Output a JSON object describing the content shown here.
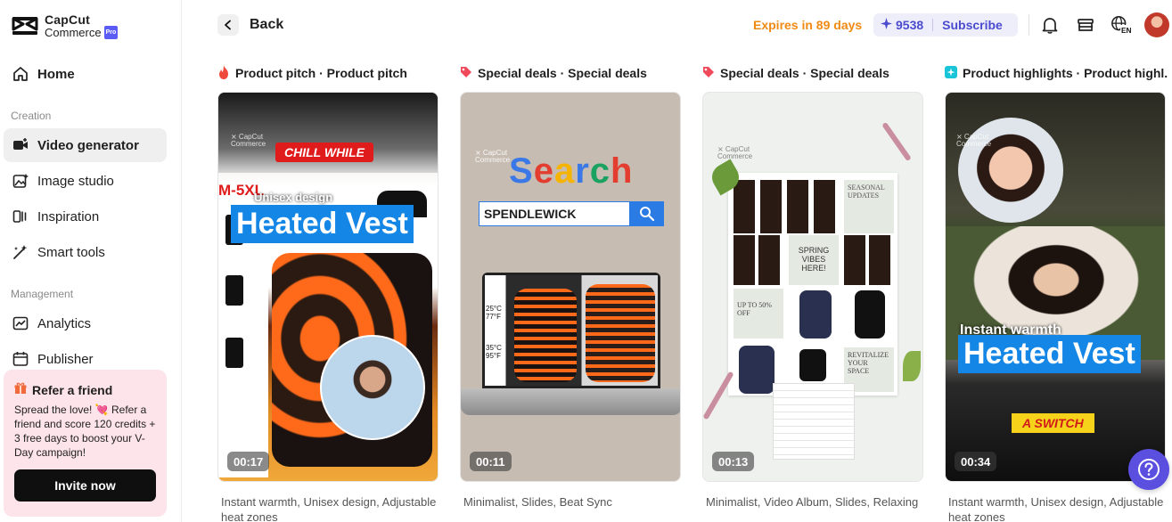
{
  "app": {
    "logo_line1": "CapCut",
    "logo_line2": "Commerce",
    "logo_badge": "Pro"
  },
  "sidebar": {
    "home_label": "Home",
    "creation_label": "Creation",
    "management_label": "Management",
    "items": [
      {
        "label": "Video generator",
        "icon": "video-plus-icon",
        "active": true
      },
      {
        "label": "Image studio",
        "icon": "image-sparkle-icon"
      },
      {
        "label": "Inspiration",
        "icon": "inspiration-icon"
      },
      {
        "label": "Smart tools",
        "icon": "magic-wand-icon"
      },
      {
        "label": "Analytics",
        "icon": "chart-icon"
      },
      {
        "label": "Publisher",
        "icon": "calendar-icon"
      }
    ],
    "refer": {
      "title": "Refer a friend",
      "body": "Spread the love! 💘 Refer a friend and score 120 credits + 3 free days to boost your V-Day campaign!",
      "button": "Invite now"
    }
  },
  "topbar": {
    "back_label": "Back",
    "expires": "Expires in 89 days",
    "credits": "9538",
    "subscribe": "Subscribe",
    "language": "EN"
  },
  "cards": [
    {
      "title": "Product pitch · Product pitch",
      "icon": "fire-icon",
      "duration": "00:17",
      "description": "Instant warmth, Unisex design, Adjustable heat zones",
      "overlay": {
        "banner": "CHILL WHILE",
        "size": "M-5XL",
        "sub": "Unisex design",
        "headline": "Heated Vest"
      }
    },
    {
      "title": "Special deals · Special deals",
      "icon": "tag-icon",
      "duration": "00:11",
      "description": "Minimalist, Slides, Beat Sync",
      "overlay": {
        "search_title": "Search",
        "search_value": "SPENDLEWICK",
        "t1": "25°C\n77°F",
        "t2": "35°C\n95°F"
      }
    },
    {
      "title": "Special deals · Special deals",
      "icon": "tag-icon",
      "duration": "00:13",
      "description": "Minimalist, Video Album, Slides, Relaxing",
      "overlay": {
        "seasonal": "SEASONAL UPDATES",
        "spring": "SPRING VIBES HERE!",
        "sale": "UP TO 50% OFF",
        "revitalize": "REVITALIZE YOUR SPACE"
      }
    },
    {
      "title": "Product highlights · Product highl...",
      "icon": "highlight-icon",
      "duration": "00:34",
      "description": "Instant warmth, Unisex design, Adjustable heat zones",
      "overlay": {
        "caption": "Instant warmth",
        "headline": "Heated Vest",
        "switch": "A SWITCH"
      }
    }
  ],
  "colors": {
    "accent": "#5b4fe0",
    "expires": "#ef8a14",
    "fire": "#f04a3c",
    "tag": "#f04a5a",
    "highlight": "#17c4d8"
  }
}
